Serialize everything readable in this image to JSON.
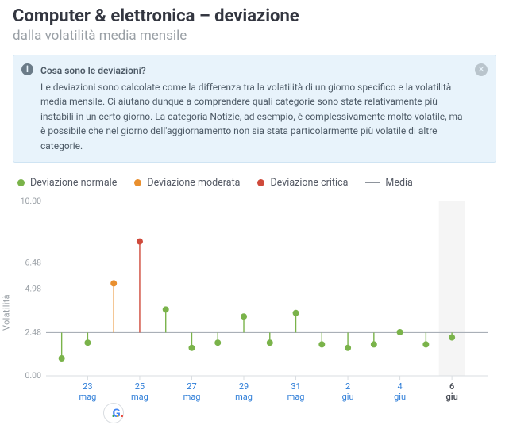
{
  "header": {
    "title": "Computer & elettronica – deviazione",
    "subtitle": "dalla volatilità media mensile"
  },
  "infobox": {
    "question": "Cosa sono le deviazioni?",
    "body": "Le deviazioni sono calcolate come la differenza tra la volatilità di un giorno specifico e la volatilità media mensile. Ci aiutano dunque a comprendere quali categorie sono state relativamente più instabili in un certo giorno. La categoria Notizie, ad esempio, è complessivamente molto volatile, ma è possibile che nel giorno dell'aggiornamento non sia stata particolarmente più volatile di altre categorie."
  },
  "legend": {
    "normal": "Deviazione normale",
    "moderate": "Deviazione moderata",
    "critical": "Deviazione critica",
    "media": "Media"
  },
  "colors": {
    "normal": "#7ab34a",
    "moderate": "#e98f2e",
    "critical": "#cf4a3b",
    "media_line": "#8e949c"
  },
  "chart_data": {
    "type": "bar",
    "ylabel": "Volatilità",
    "ylim": [
      0,
      10
    ],
    "y_ticks": [
      0.0,
      2.48,
      4.98,
      6.48,
      10.0
    ],
    "media": 2.48,
    "x_ticks": [
      {
        "idx": 1,
        "top": "23",
        "bottom": "mag",
        "class": "link"
      },
      {
        "idx": 3,
        "top": "25",
        "bottom": "mag",
        "class": "link"
      },
      {
        "idx": 5,
        "top": "27",
        "bottom": "mag",
        "class": "link"
      },
      {
        "idx": 7,
        "top": "29",
        "bottom": "mag",
        "class": "link"
      },
      {
        "idx": 9,
        "top": "31",
        "bottom": "mag",
        "class": "link"
      },
      {
        "idx": 11,
        "top": "2",
        "bottom": "giu",
        "class": "link"
      },
      {
        "idx": 13,
        "top": "4",
        "bottom": "giu",
        "class": "link"
      },
      {
        "idx": 15,
        "top": "6",
        "bottom": "giu",
        "class": "strong"
      }
    ],
    "highlight_band_idx": 15,
    "google_marker_idx": 2,
    "series": [
      {
        "idx": 0,
        "value": 1.0,
        "level": "normal"
      },
      {
        "idx": 1,
        "value": 1.9,
        "level": "normal"
      },
      {
        "idx": 2,
        "value": 5.3,
        "level": "moderate"
      },
      {
        "idx": 3,
        "value": 7.7,
        "level": "critical"
      },
      {
        "idx": 4,
        "value": 3.8,
        "level": "normal"
      },
      {
        "idx": 5,
        "value": 1.6,
        "level": "normal"
      },
      {
        "idx": 6,
        "value": 1.9,
        "level": "normal"
      },
      {
        "idx": 7,
        "value": 3.4,
        "level": "normal"
      },
      {
        "idx": 8,
        "value": 1.9,
        "level": "normal"
      },
      {
        "idx": 9,
        "value": 3.6,
        "level": "normal"
      },
      {
        "idx": 10,
        "value": 1.8,
        "level": "normal"
      },
      {
        "idx": 11,
        "value": 1.6,
        "level": "normal"
      },
      {
        "idx": 12,
        "value": 1.8,
        "level": "normal"
      },
      {
        "idx": 13,
        "value": 2.5,
        "level": "normal"
      },
      {
        "idx": 14,
        "value": 1.8,
        "level": "normal"
      },
      {
        "idx": 15,
        "value": 2.2,
        "level": "normal"
      }
    ]
  }
}
